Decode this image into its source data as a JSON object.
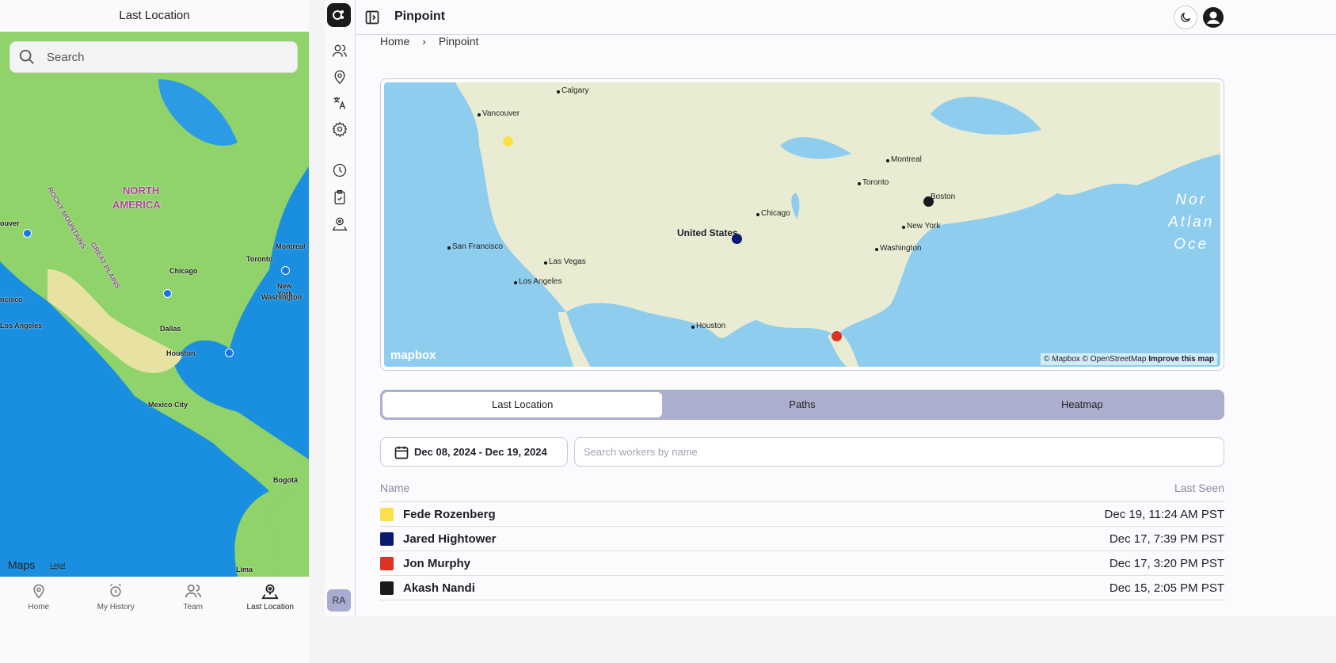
{
  "phone": {
    "title": "Last Location",
    "search_placeholder": "Search",
    "map_labels": [
      "NORTH",
      "AMERICA",
      "ROCKY MOUNTAINS",
      "GREAT PLAINS",
      "Chicago",
      "Toronto",
      "Montreal",
      "New York",
      "Washington",
      "Dallas",
      "Houston",
      "Mexico City",
      "Bogotá",
      "Lima",
      "Los Angeles",
      "ouver",
      "ncisco"
    ],
    "attribution": "Maps",
    "legal": "Legal",
    "tabs": [
      {
        "label": "Home",
        "icon": "map-pin-icon"
      },
      {
        "label": "My History",
        "icon": "alarm-clock-icon"
      },
      {
        "label": "Team",
        "icon": "users-icon"
      },
      {
        "label": "Last Location",
        "icon": "user-pin-icon",
        "active": true
      }
    ]
  },
  "rail": {
    "icons": [
      "users-icon",
      "map-pin-icon",
      "translate-icon",
      "gear-icon",
      "clock-icon",
      "clipboard-check-icon",
      "user-pin-icon"
    ],
    "avatar": "RA"
  },
  "header": {
    "title": "Pinpoint"
  },
  "breadcrumb": {
    "home": "Home",
    "sep": "›",
    "current": "Pinpoint"
  },
  "map": {
    "labels": [
      "Calgary",
      "Vancouver",
      "Montreal",
      "Toronto",
      "Boston",
      "Chicago",
      "New York",
      "Washington",
      "San Francisco",
      "Las Vegas",
      "Los Angeles",
      "Houston"
    ],
    "country": "United States",
    "ocean": [
      "Nor",
      "Atlan",
      "Oce"
    ],
    "logo": "mapbox",
    "attribution": "© Mapbox © OpenStreetMap",
    "improve": "Improve this map"
  },
  "tabs": [
    {
      "label": "Last Location",
      "active": true
    },
    {
      "label": "Paths"
    },
    {
      "label": "Heatmap"
    }
  ],
  "filters": {
    "date_range": "Dec 08, 2024 - Dec 19, 2024",
    "search_placeholder": "Search workers by name"
  },
  "table": {
    "headers": [
      "Name",
      "Last Seen"
    ],
    "rows": [
      {
        "name": "Fede Rozenberg",
        "last_seen": "Dec 19, 11:24 AM PST",
        "color": "#fbe04a"
      },
      {
        "name": "Jared Hightower",
        "last_seen": "Dec 17, 7:39 PM PST",
        "color": "#0b1a6e"
      },
      {
        "name": "Jon Murphy",
        "last_seen": "Dec 17, 3:20 PM PST",
        "color": "#dd3322"
      },
      {
        "name": "Akash Nandi",
        "last_seen": "Dec 15, 2:05 PM PST",
        "color": "#1a1a1a"
      }
    ]
  }
}
